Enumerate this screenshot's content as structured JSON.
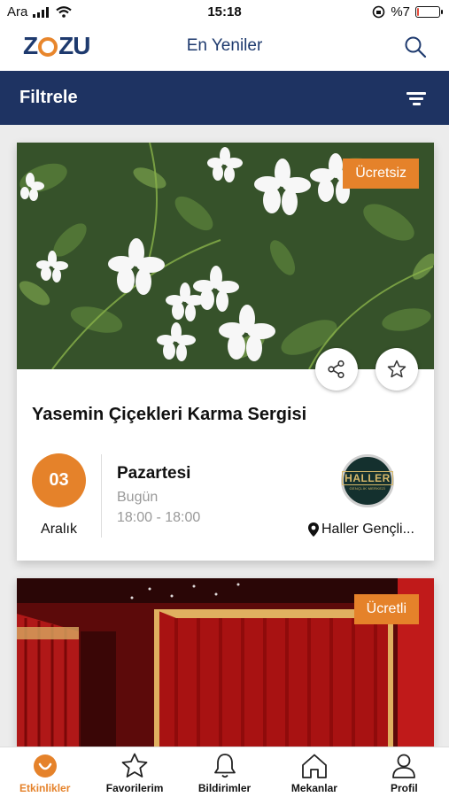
{
  "status_bar": {
    "carrier": "Ara",
    "time": "15:18",
    "battery": "%7",
    "battery_level": 0.07
  },
  "app_bar": {
    "logo": "ZOZU",
    "title": "En Yeniler"
  },
  "filter_bar": {
    "title": "Filtrele"
  },
  "events": [
    {
      "price": "Ücretsiz",
      "title": "Yasemin Çiçekleri Karma Sergisi",
      "day_number": "03",
      "month": "Aralık",
      "weekday": "Pazartesi",
      "relative_day": "Bugün",
      "hours": "18:00 - 18:00",
      "venue_logo_text": "HALLER",
      "venue_logo_subtext": "GENÇLİK MERKEZİ",
      "venue": "Haller Gençli..."
    },
    {
      "price": "Ücretli"
    }
  ],
  "tabs": [
    {
      "label": "Etkinlikler",
      "icon": "smiley-icon",
      "active": true
    },
    {
      "label": "Favorilerim",
      "icon": "star-icon",
      "active": false
    },
    {
      "label": "Bildirimler",
      "icon": "bell-icon",
      "active": false
    },
    {
      "label": "Mekanlar",
      "icon": "home-icon",
      "active": false
    },
    {
      "label": "Profil",
      "icon": "user-icon",
      "active": false
    }
  ],
  "colors": {
    "accent": "#e5822a",
    "navy": "#1e3362",
    "brand_text": "#1e3a6e"
  }
}
